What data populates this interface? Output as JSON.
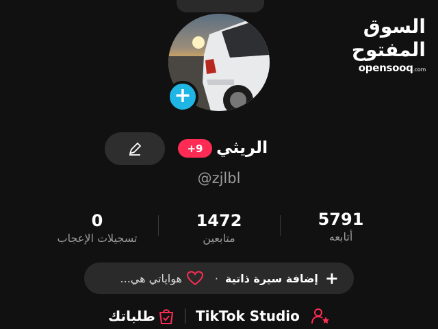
{
  "watermark": {
    "arabic": "السوق المفتوح",
    "latin": "opensooq",
    "suffix": ".com"
  },
  "profile": {
    "name": "الريثي",
    "notifications_badge": "+9",
    "username": "@zjlbl",
    "add_icon": "plus-icon",
    "edit_icon": "pencil-icon"
  },
  "stats": {
    "following": {
      "value": "5791",
      "label": "أتابعه"
    },
    "followers": {
      "value": "1472",
      "label": "متابعين"
    },
    "likes": {
      "value": "0",
      "label": "تسجيلات الإعجاب"
    }
  },
  "bio": {
    "add_label": "إضافة سيرة ذاتية",
    "dot": "·",
    "hobbies_label": "هواياتي هي..."
  },
  "bottom": {
    "studio_label": "TikTok Studio",
    "orders_label": "طلباتك"
  },
  "colors": {
    "background": "#111111",
    "badge": "#fe2c55",
    "add_button": "#1fb6e6",
    "accent_pink": "#fe2c55"
  }
}
